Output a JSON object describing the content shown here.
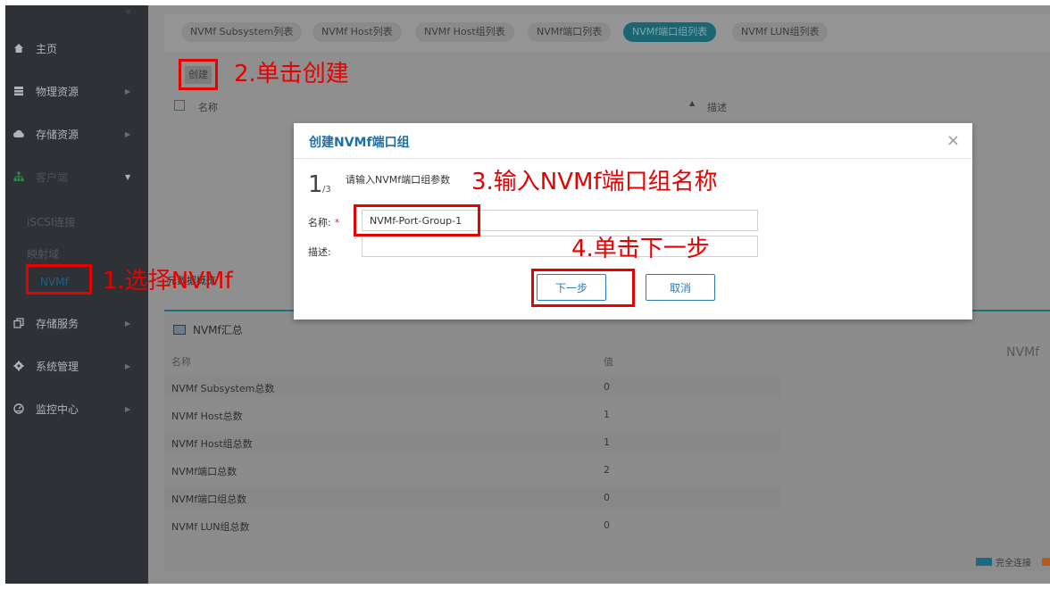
{
  "sidebar": {
    "items": [
      {
        "label": "主页",
        "icon": "home-icon"
      },
      {
        "label": "物理资源",
        "icon": "server-icon"
      },
      {
        "label": "存储资源",
        "icon": "cloud-icon"
      },
      {
        "label": "客户端",
        "icon": "network-icon"
      },
      {
        "label": "存储服务",
        "icon": "copy-icon"
      },
      {
        "label": "系统管理",
        "icon": "gear-icon"
      },
      {
        "label": "监控中心",
        "icon": "monitor-icon"
      }
    ],
    "sub_items": [
      "iSCSI连接",
      "映射域",
      "NVMf"
    ]
  },
  "tabs": [
    "NVMf Subsystem列表",
    "NVMf Host列表",
    "NVMf Host组列表",
    "NVMf端口列表",
    "NVMf端口组列表",
    "NVMf LUN组列表"
  ],
  "toolbar": {
    "create_label": "创建"
  },
  "table": {
    "col_name": "名称",
    "col_desc": "描述"
  },
  "section_tab": "元数据概览",
  "panel": {
    "title": "NVMf汇总",
    "head_name": "名称",
    "head_value": "值",
    "rows": [
      {
        "label": "NVMf Subsystem总数",
        "value": "0"
      },
      {
        "label": "NVMf Host总数",
        "value": "1"
      },
      {
        "label": "NVMf Host组总数",
        "value": "1"
      },
      {
        "label": "NVMf端口总数",
        "value": "2"
      },
      {
        "label": "NVMf端口组总数",
        "value": "0"
      },
      {
        "label": "NVMf LUN组总数",
        "value": "0"
      }
    ],
    "right_label": "NVMf",
    "legend": "完全连接"
  },
  "dialog": {
    "title": "创建NVMf端口组",
    "step_current": "1",
    "step_total": "/3",
    "step_desc": "请输入NVMf端口组参数",
    "name_label": "名称:",
    "required_mark": "*",
    "name_value": "NVMf-Port-Group-1",
    "desc_label": "描述:",
    "desc_value": "",
    "next_label": "下一步",
    "cancel_label": "取消",
    "close_glyph": "×"
  },
  "annotations": {
    "step1": "1.选择NVMf",
    "step2": "2.单击创建",
    "step3": "3.输入NVMf端口组名称",
    "step4": "4.单击下一步"
  },
  "colors": {
    "accent": "#1d6fa5",
    "annotation": "#e60000",
    "active_tab": "#1c6672"
  }
}
